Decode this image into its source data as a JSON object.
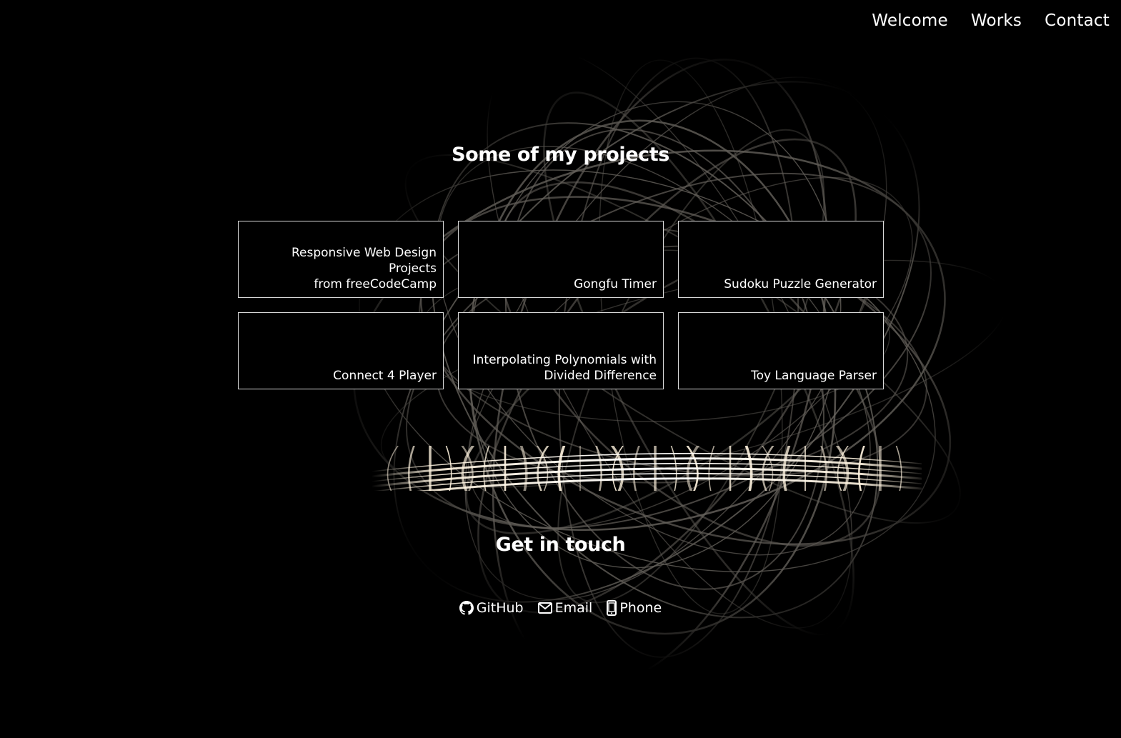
{
  "nav": {
    "items": [
      {
        "label": "Welcome"
      },
      {
        "label": "Works"
      },
      {
        "label": "Contact"
      }
    ]
  },
  "projects": {
    "title": "Some of my projects",
    "cards": [
      {
        "line1": "Responsive Web Design Projects",
        "line2": "from freeCodeCamp"
      },
      {
        "line1": "Gongfu Timer",
        "line2": ""
      },
      {
        "line1": "Sudoku Puzzle Generator",
        "line2": ""
      },
      {
        "line1": "Connect 4 Player",
        "line2": ""
      },
      {
        "line1": "Interpolating Polynomials with",
        "line2": "Divided Difference"
      },
      {
        "line1": "Toy Language Parser",
        "line2": ""
      }
    ]
  },
  "contact": {
    "title": "Get in touch",
    "links": [
      {
        "label": "GitHub",
        "icon": "github-icon"
      },
      {
        "label": "Email",
        "icon": "envelope-icon"
      },
      {
        "label": "Phone",
        "icon": "mobile-phone-icon"
      }
    ]
  },
  "colors": {
    "background": "#000000",
    "text": "#ffffff",
    "card_border": "#d9d9d9",
    "light_trails": "#d8d0c4"
  }
}
